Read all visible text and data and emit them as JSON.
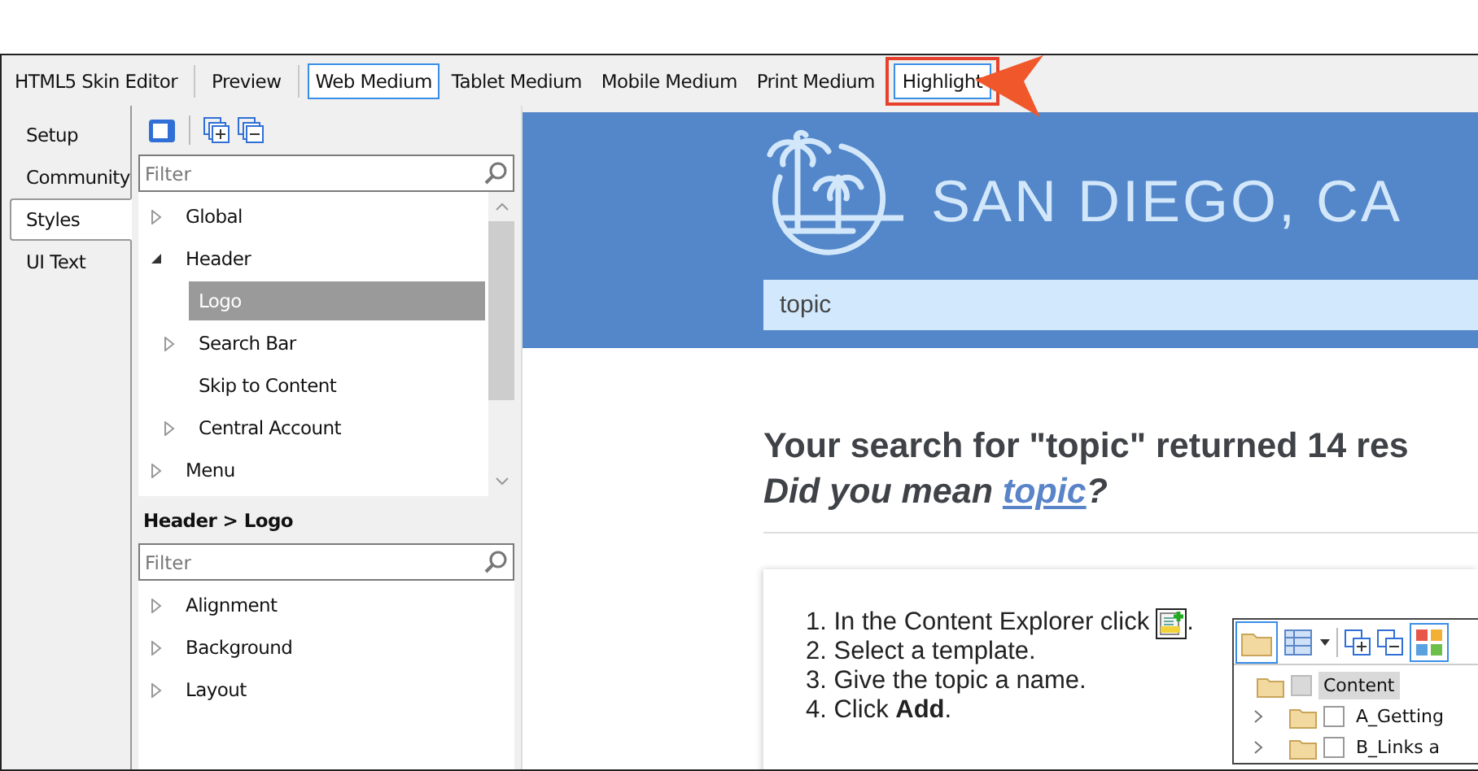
{
  "toolbar": {
    "items": [
      {
        "label": "HTML5 Skin Editor",
        "selected": false,
        "separator_after": true,
        "callout": false
      },
      {
        "label": "Preview",
        "selected": false,
        "separator_after": true,
        "callout": false
      },
      {
        "label": "Web Medium",
        "selected": true,
        "separator_after": false,
        "callout": false
      },
      {
        "label": "Tablet Medium",
        "selected": false,
        "separator_after": false,
        "callout": false
      },
      {
        "label": "Mobile Medium",
        "selected": false,
        "separator_after": false,
        "callout": false
      },
      {
        "label": "Print Medium",
        "selected": false,
        "separator_after": false,
        "callout": false
      },
      {
        "label": "Highlight",
        "selected": true,
        "separator_after": false,
        "callout": true
      }
    ]
  },
  "side_tabs": [
    {
      "label": "Setup",
      "selected": false
    },
    {
      "label": "Community",
      "selected": false
    },
    {
      "label": "Styles",
      "selected": true
    },
    {
      "label": "UI Text",
      "selected": false
    }
  ],
  "styles_panel": {
    "filter": {
      "placeholder": "Filter"
    },
    "tree": [
      {
        "label": "Global",
        "has_children": true,
        "expanded": false,
        "selected": false
      },
      {
        "label": "Header",
        "has_children": true,
        "expanded": true,
        "selected": false,
        "children": [
          {
            "label": "Logo",
            "has_children": false,
            "selected": true
          },
          {
            "label": "Search Bar",
            "has_children": true,
            "expanded": false,
            "selected": false
          },
          {
            "label": "Skip to Content",
            "has_children": false,
            "selected": false
          },
          {
            "label": "Central Account",
            "has_children": true,
            "expanded": false,
            "selected": false
          }
        ]
      },
      {
        "label": "Menu",
        "has_children": true,
        "expanded": false,
        "selected": false
      }
    ],
    "breadcrumb": "Header > Logo",
    "property_filter": {
      "placeholder": "Filter"
    },
    "properties": [
      {
        "label": "Alignment",
        "has_children": true,
        "expanded": false
      },
      {
        "label": "Background",
        "has_children": true,
        "expanded": false
      },
      {
        "label": "Layout",
        "has_children": true,
        "expanded": false
      }
    ]
  },
  "preview": {
    "site_title": "SAN DIEGO, CA",
    "search": {
      "value": "topic"
    },
    "heading": "Your search for \"topic\" returned 14 res",
    "suggestion": {
      "before": "Did you mean ",
      "link": "topic",
      "after": "?"
    },
    "steps": [
      {
        "kind": "with_icon",
        "text": "1. In the Content Explorer click",
        "suffix": "."
      },
      {
        "kind": "plain",
        "text": "2. Select a template."
      },
      {
        "kind": "plain",
        "text": "3. Give the topic a name."
      },
      {
        "kind": "plain",
        "text": "4. Click **Add**."
      }
    ],
    "explorer": {
      "rows": [
        {
          "label": "Content",
          "kind": "root",
          "selected": true,
          "checked": false
        },
        {
          "label": "A_Getting",
          "kind": "folder",
          "selected": false,
          "checked": false
        },
        {
          "label": "B_Links a",
          "kind": "folder",
          "selected": false,
          "checked": false
        }
      ]
    }
  }
}
